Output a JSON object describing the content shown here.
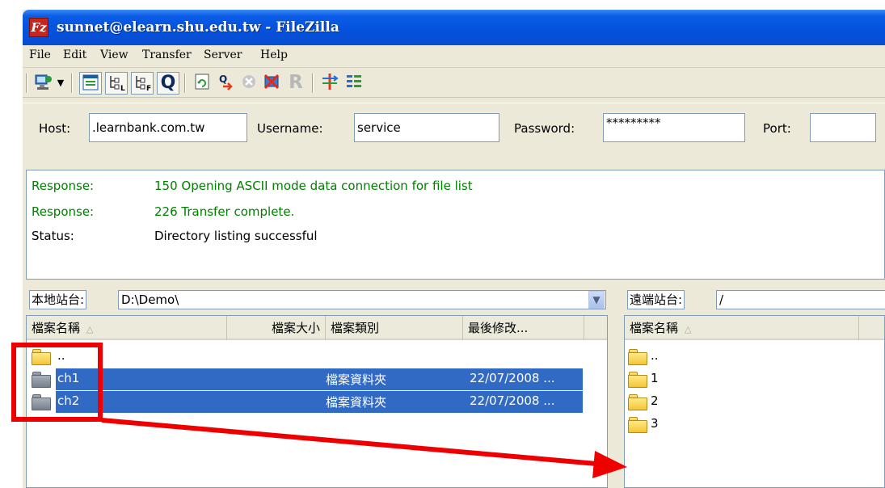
{
  "window": {
    "title": "sunnet@elearn.shu.edu.tw - FileZilla",
    "icon": "filezilla-icon"
  },
  "menu": [
    "File",
    "Edit",
    "View",
    "Transfer",
    "Server",
    "Help"
  ],
  "toolbar": {
    "icons": [
      "site-manager-icon",
      "dropdown-arrow-icon",
      "toggle-log-icon",
      "toggle-local-tree-icon",
      "toggle-remote-tree-icon",
      "toggle-queue-icon",
      "refresh-icon",
      "process-queue-icon",
      "cancel-icon",
      "disconnect-icon",
      "reconnect-icon",
      "compare-icon",
      "sync-browse-icon"
    ],
    "reconnect_glyph": "R",
    "queue_glyph": "Q"
  },
  "quickconnect": {
    "host_label": "Host:",
    "host_value": ".learnbank.com.tw",
    "username_label": "Username:",
    "username_value": "service",
    "password_label": "Password:",
    "password_value": "*********",
    "port_label": "Port:",
    "port_value": ""
  },
  "log": [
    {
      "type": "Response:",
      "message": "150 Opening ASCII mode data connection for file list",
      "color": "#008000"
    },
    {
      "type": "Response:",
      "message": "226 Transfer complete.",
      "color": "#008000"
    },
    {
      "type": "Status:",
      "message": "Directory listing successful",
      "color": "#000000"
    }
  ],
  "local": {
    "site_label": "本地站台:",
    "path": "D:\\Demo\\",
    "columns": {
      "name": "檔案名稱",
      "size": "檔案大小",
      "type": "檔案類別",
      "modified": "最後修改..."
    },
    "files": [
      {
        "name": "..",
        "type": "",
        "modified": "",
        "icon": "yellow-folder-icon",
        "selected": false
      },
      {
        "name": "ch1",
        "type": "檔案資料夾",
        "modified": "22/07/2008 ...",
        "icon": "gray-folder-icon",
        "selected": true
      },
      {
        "name": "ch2",
        "type": "檔案資料夾",
        "modified": "22/07/2008 ...",
        "icon": "gray-folder-icon",
        "selected": true
      }
    ]
  },
  "remote": {
    "site_label": "遠端站台:",
    "path": "/",
    "columns": {
      "name": "檔案名稱"
    },
    "files": [
      {
        "name": "..",
        "icon": "yellow-folder-icon"
      },
      {
        "name": "1",
        "icon": "yellow-folder-icon"
      },
      {
        "name": "2",
        "icon": "yellow-folder-icon"
      },
      {
        "name": "3",
        "icon": "yellow-folder-icon"
      }
    ]
  },
  "annotation": {
    "color": "#ee0000"
  }
}
